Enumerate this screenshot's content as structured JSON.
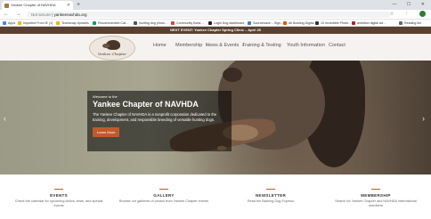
{
  "browser": {
    "tab_title": "Yankee Chapter of NAVHDA",
    "new_tab": "+",
    "window_controls": "— ☐ ✕",
    "nav_buttons": "← → ⟳",
    "address": {
      "security": "Not secure",
      "host": "yankeenavhda.org"
    },
    "address_icons": "☆ ⋮"
  },
  "bookmarks": [
    {
      "label": "Apps",
      "color": "#4285f4"
    },
    {
      "label": "Imported From IE (1)",
      "color": "#f4b400"
    },
    {
      "label": "Teamsnap Upstairs",
      "color": "#f4b400"
    },
    {
      "label": "Recommended Cat…",
      "color": "#0f9d58"
    },
    {
      "label": "hunting dog photo…",
      "color": "#555555"
    },
    {
      "label": "Community Bank…",
      "color": "#db4437"
    },
    {
      "label": "Login Dog dashboard",
      "color": "#222222"
    },
    {
      "label": "Sourcewave – Sign…",
      "color": "#3f7fbf"
    },
    {
      "label": "All Bowling Digital",
      "color": "#e65100"
    },
    {
      "label": "10 Incredible Photo…",
      "color": "#333333"
    },
    {
      "label": "ambition digital ad…",
      "color": "#b71c1c"
    },
    {
      "label": "Reading list",
      "color": "#666666"
    }
  ],
  "site": {
    "announcement": "NEXT EVENT: Yankee Chapter Spring Clinic – April 25",
    "logo_text": "Yankee Chapter",
    "menu": {
      "home": "Home",
      "membership": "Membership",
      "news": "News & Events",
      "training": "Training & Testing",
      "youth": "Youth Information",
      "contact": "Contact"
    },
    "hero": {
      "welcome": "Welcome to the",
      "title": "Yankee Chapter of NAVHDA",
      "text": "The Yankee Chapter of NAVHDA is a nonprofit corporation dedicated to the training, development, and responsible breeding of versatile hunting dogs.",
      "button": "Learn More",
      "prev": "‹",
      "next": "›"
    },
    "features": [
      {
        "title": "EVENTS",
        "desc": "Check the calendar for upcoming clinics, tests, and special events"
      },
      {
        "title": "GALLERY",
        "desc": "Browse our galleries of photos from Yankee Chapter events"
      },
      {
        "title": "NEWSLETTER",
        "desc": "Read the Barking Dog Express"
      },
      {
        "title": "MEMBERSHIP",
        "desc": "Search for Yankee Chapter and NAVHDA International members"
      }
    ]
  }
}
